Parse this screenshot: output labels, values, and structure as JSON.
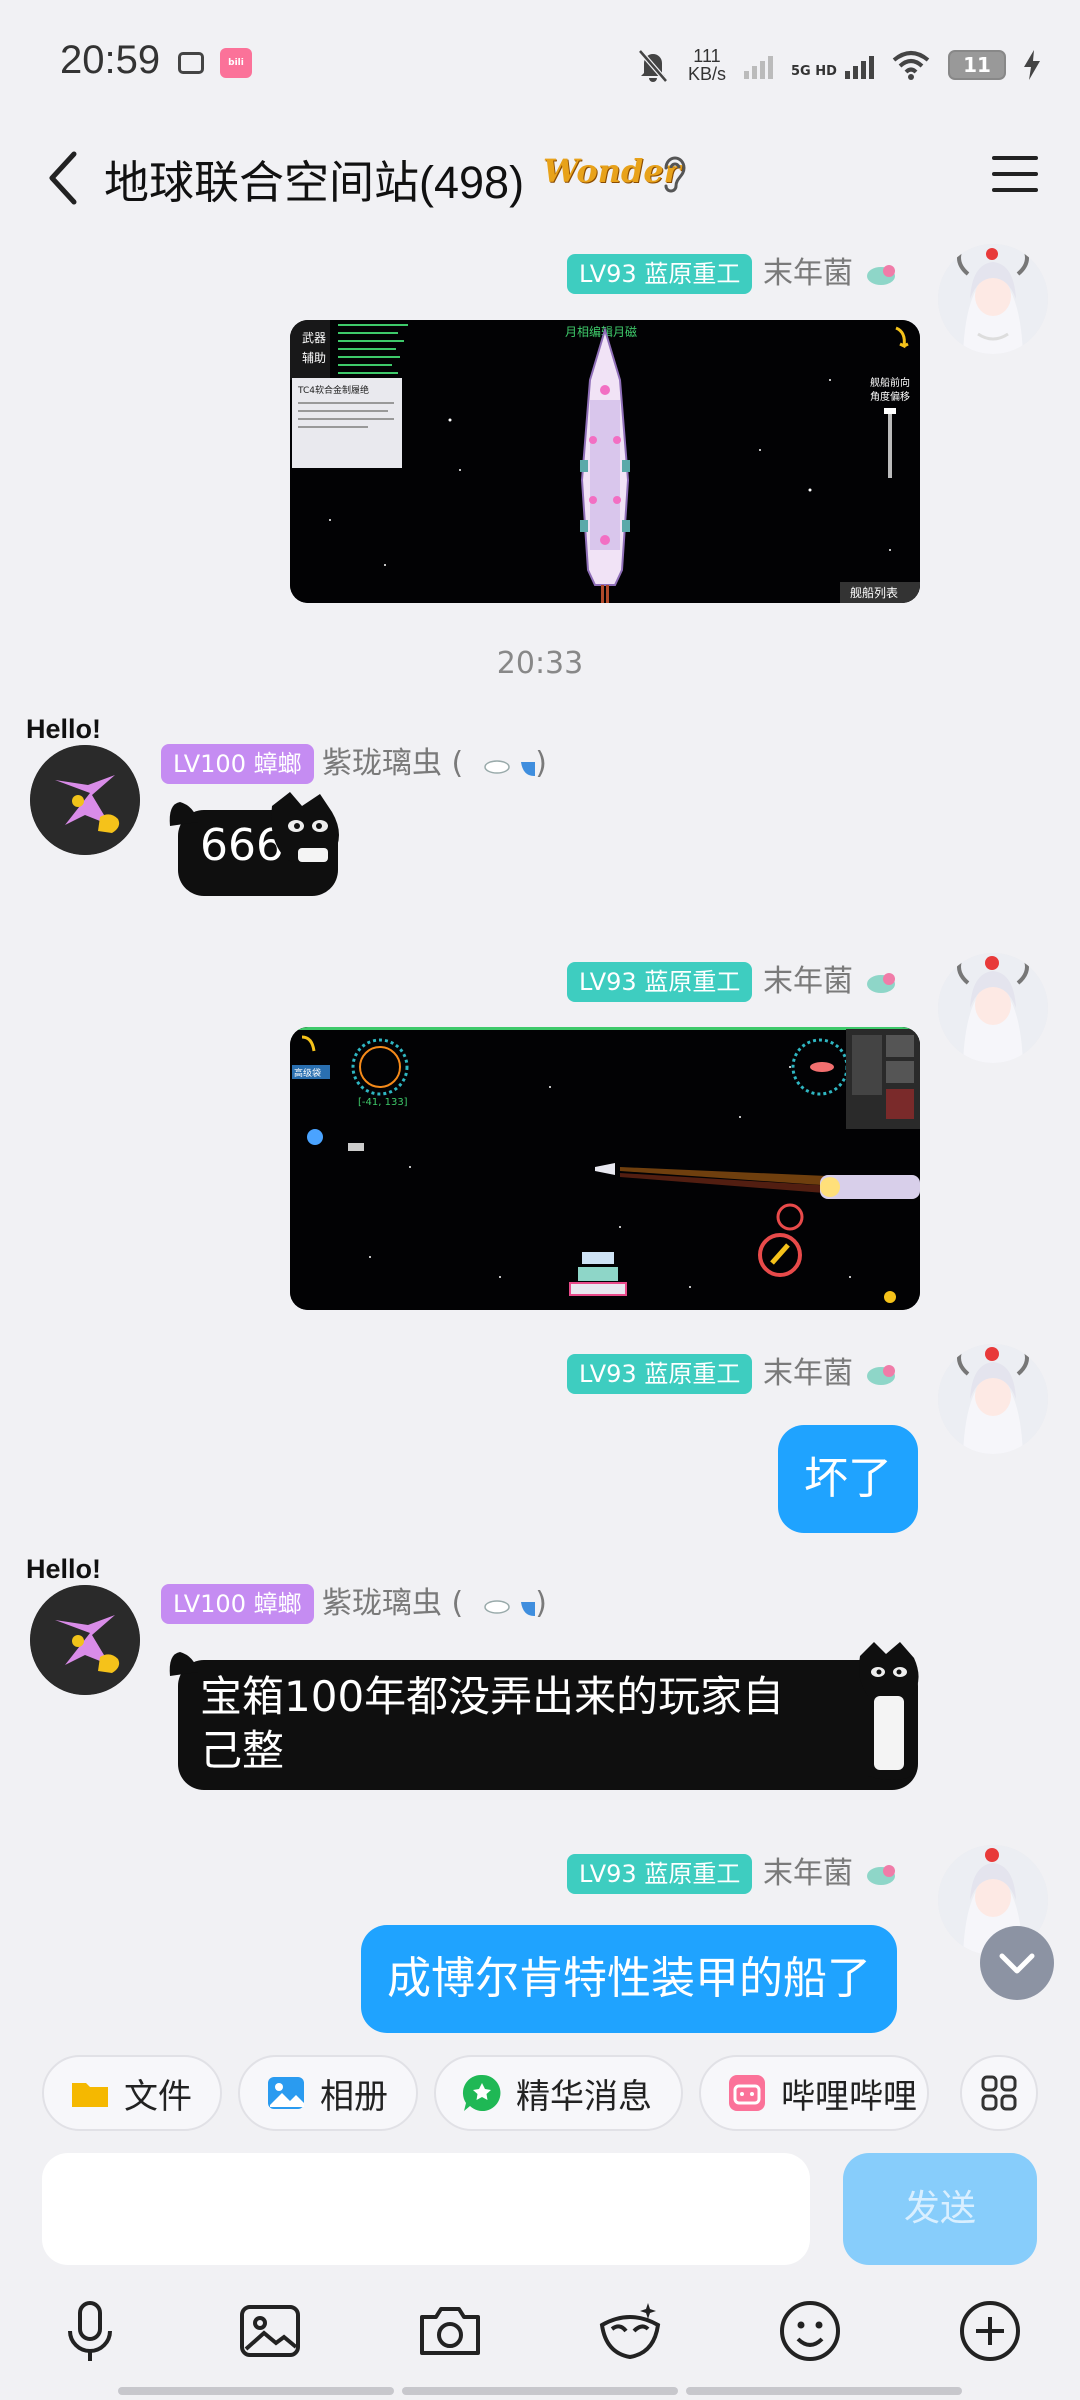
{
  "status_bar": {
    "time": "20:59",
    "net_speed_value": "111",
    "net_speed_unit": "KB/s",
    "network": "5G HD",
    "battery": "11"
  },
  "header": {
    "title": "地球联合空间站(498)",
    "badge": "Wonder"
  },
  "messages": {
    "timestamp": "20:33",
    "m1": {
      "level": "LV93",
      "level_title": "蓝原重工",
      "sender": "末年菌"
    },
    "m2": {
      "hello": "Hello!",
      "level": "LV100",
      "level_title": "蟑螂",
      "sender": "紫珑璃虫 (",
      "sender_suffix": ")",
      "text": "666"
    },
    "m3": {
      "level": "LV93",
      "level_title": "蓝原重工",
      "sender": "末年菌"
    },
    "m4": {
      "level": "LV93",
      "level_title": "蓝原重工",
      "sender": "末年菌",
      "text": "坏了"
    },
    "m5": {
      "hello": "Hello!",
      "level": "LV100",
      "level_title": "蟑螂",
      "sender": "紫珑璃虫 (",
      "sender_suffix": ")",
      "text_line1": "宝箱100年都没弄出来的玩家自",
      "text_line2": "己整"
    },
    "m6": {
      "level": "LV93",
      "level_title": "蓝原重工",
      "sender": "末年菌",
      "text": "成博尔肯特性装甲的船了"
    },
    "game1": {
      "menu_1": "武器",
      "menu_2": "辅助",
      "top_label": "月相编辑月磁",
      "side_label_1": "舰船前向",
      "side_label_2": "角度偏移",
      "bottom_right": "舰船列表",
      "panel_title": "TC4软合金制履绝"
    },
    "game2": {
      "coords": "[-41, 133]",
      "hud_tag": "高级袋"
    }
  },
  "shortcuts": {
    "file": "文件",
    "album": "相册",
    "highlights": "精华消息",
    "bilibili": "哔哩哔哩"
  },
  "input": {
    "placeholder": "",
    "send": "发送"
  },
  "colors": {
    "blue_bubble": "#1fa3ff",
    "tag_teal": "#3ecdc0",
    "tag_purple": "#c58cf2",
    "send_disabled": "#87cdfb"
  }
}
